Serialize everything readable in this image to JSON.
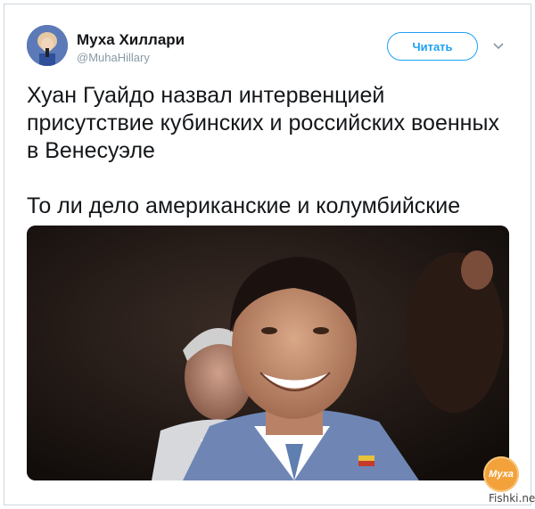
{
  "author": {
    "display_name": "Муха Хиллари",
    "handle": "@MuhaHillary",
    "avatar_icon": "user-avatar"
  },
  "actions": {
    "follow_label": "Читать",
    "menu_icon": "chevron-down-icon"
  },
  "tweet": {
    "paragraph_1": "Хуан Гуайдо назвал интервенцией присутствие кубинских и российских военных в Венесуэле",
    "paragraph_2": "То ли дело американские и колумбийские"
  },
  "media": {
    "type": "photo"
  },
  "watermark": {
    "badge": "Муха",
    "site": "Fishki.net"
  },
  "colors": {
    "accent": "#1da1f2",
    "text": "#14171a",
    "secondary": "#8899a6"
  }
}
